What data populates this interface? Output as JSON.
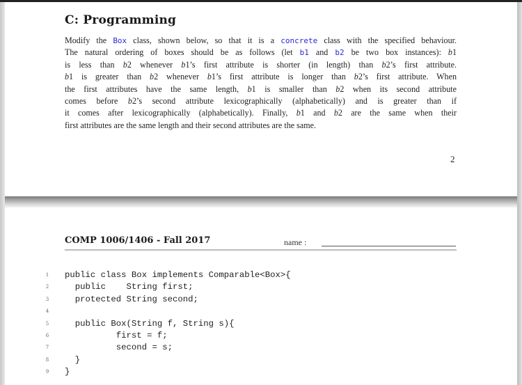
{
  "viewer": {
    "pages": [
      {
        "section_title": "C: Programming",
        "paragraph_lines": [
          [
            {
              "t": "Modify the "
            },
            {
              "t": "Box",
              "code": true
            },
            {
              "t": " class, shown below, so that it is a "
            },
            {
              "t": "concrete",
              "code": true
            },
            {
              "t": " class with the specified behaviour."
            }
          ],
          [
            {
              "t": "The natural ordering of boxes should be as follows (let "
            },
            {
              "t": "b1",
              "code": true
            },
            {
              "t": " and "
            },
            {
              "t": "b2",
              "code": true
            },
            {
              "t": " be two box instances): "
            },
            {
              "t": "b",
              "math": true
            },
            {
              "t": "1"
            }
          ],
          [
            {
              "t": "is less than "
            },
            {
              "t": "b",
              "math": true
            },
            {
              "t": "2 whenever "
            },
            {
              "t": "b",
              "math": true
            },
            {
              "t": "1’s first attribute is shorter (in length) than "
            },
            {
              "t": "b",
              "math": true
            },
            {
              "t": "2’s first attribute."
            }
          ],
          [
            {
              "t": "b",
              "math": true
            },
            {
              "t": "1 is greater than "
            },
            {
              "t": "b",
              "math": true
            },
            {
              "t": "2 whenever "
            },
            {
              "t": "b",
              "math": true
            },
            {
              "t": "1’s first attribute is longer than "
            },
            {
              "t": "b",
              "math": true
            },
            {
              "t": "2’s first attribute.  When"
            }
          ],
          [
            {
              "t": "the first attributes have the same length, "
            },
            {
              "t": "b",
              "math": true
            },
            {
              "t": "1 is smaller than "
            },
            {
              "t": "b",
              "math": true
            },
            {
              "t": "2 when its second attribute"
            }
          ],
          [
            {
              "t": "comes before "
            },
            {
              "t": "b",
              "math": true
            },
            {
              "t": "2’s second attribute lexicographically (alphabetically) and is greater than if"
            }
          ],
          [
            {
              "t": "it comes after lexicographically (alphabetically). Finally, "
            },
            {
              "t": "b",
              "math": true
            },
            {
              "t": "1 and "
            },
            {
              "t": "b",
              "math": true
            },
            {
              "t": "2 are the same when their"
            }
          ],
          [
            {
              "t": "first attributes are the same length and their second attributes are the same."
            }
          ]
        ],
        "page_number": "2"
      },
      {
        "header_course": "COMP 1006/1406 - Fall 2017",
        "header_name_label": "name :",
        "code_lines": [
          {
            "n": "1",
            "text": "public class Box implements Comparable<Box>{"
          },
          {
            "n": "2",
            "text": "  public    String first;"
          },
          {
            "n": "3",
            "text": "  protected String second;"
          },
          {
            "n": "4",
            "text": ""
          },
          {
            "n": "5",
            "text": "  public Box(String f, String s){"
          },
          {
            "n": "6",
            "text": "          first = f;"
          },
          {
            "n": "7",
            "text": "          second = s;"
          },
          {
            "n": "8",
            "text": "  }"
          },
          {
            "n": "9",
            "text": "}"
          }
        ]
      }
    ]
  }
}
